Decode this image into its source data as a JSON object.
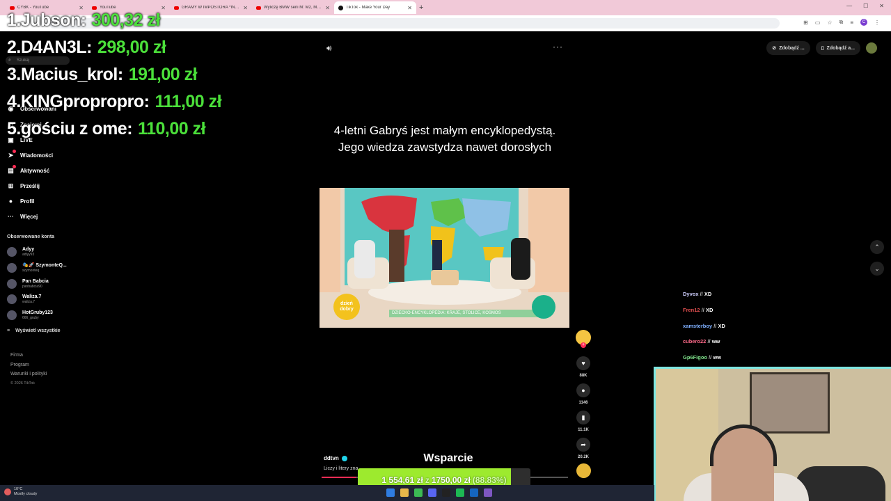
{
  "browser": {
    "tabs": [
      {
        "label": "CYBK - YouTube",
        "icon": "youtube-icon"
      },
      {
        "label": "YouTube",
        "icon": "youtube-icon"
      },
      {
        "label": "GRAMY W IMPOSTORA *INTEL",
        "icon": "youtube-icon"
      },
      {
        "label": "Wyliczę BMW serii M: M2, M3, M",
        "icon": "youtube-icon"
      },
      {
        "label": "TikTok - Make Your Day",
        "icon": "tiktok-icon",
        "active": true
      }
    ],
    "new_tab": "+"
  },
  "leaderboard": [
    {
      "rank_name": "1.Jubson:",
      "amount": "300,32 zł"
    },
    {
      "rank_name": "2.D4AN3L:",
      "amount": "298,00 zł"
    },
    {
      "rank_name": "3.Macius_krol:",
      "amount": "191,00 zł"
    },
    {
      "rank_name": "4.KINGpropropro:",
      "amount": "111,00 zł"
    },
    {
      "rank_name": "5.gościu z ome:",
      "amount": "110,00 zł"
    }
  ],
  "sidebar": {
    "search_placeholder": "Szukaj",
    "items": [
      {
        "label": "Obserwowani",
        "icon": "users-icon"
      },
      {
        "label": "Znajomi",
        "icon": "friends-icon"
      },
      {
        "label": "LIVE",
        "icon": "live-icon"
      },
      {
        "label": "Wiadomości",
        "icon": "messages-icon"
      },
      {
        "label": "Aktywność",
        "icon": "activity-icon"
      },
      {
        "label": "Prześlij",
        "icon": "upload-icon"
      },
      {
        "label": "Profil",
        "icon": "profile-icon"
      },
      {
        "label": "Więcej",
        "icon": "more-icon"
      }
    ],
    "following_title": "Obserwowane konta",
    "following": [
      {
        "name": "Adyy",
        "user": "adiyy93"
      },
      {
        "name": "🎭🚀 SzymonteQ...",
        "user": "szymonteq"
      },
      {
        "name": "Pan Babcia",
        "user": "panbabcia90"
      },
      {
        "name": "Waliza.7",
        "user": "waliza.7"
      },
      {
        "name": "HotGruby123",
        "user": "666_gruby"
      }
    ],
    "show_all": "Wyświetl wszystkie",
    "footer": [
      "Firma",
      "Program",
      "Warunki i polityki"
    ],
    "copyright": "© 2026 TikTok"
  },
  "top_right": {
    "btn1": "Zdobądź ...",
    "btn2": "Zdobądź a..."
  },
  "video": {
    "caption": "4-letni Gabryś jest małym encyklopedystą. Jego wiedza zawstydza nawet dorosłych",
    "clip_logo": "dzień dobry",
    "clip_ticker": "DZIECKO-ENCYKLOPEDIA: KRAJE, STOLICE, KOSMOS",
    "author": "ddtvn",
    "description": "Liczy i litery zna...",
    "progress": 0.14,
    "counts": {
      "likes": "88K",
      "comments": "1146",
      "saves": "11.1K",
      "shares": "20.2K"
    }
  },
  "chat": [
    {
      "user": "Dyvox",
      "color": "#cfcfff",
      "msg": "XD"
    },
    {
      "user": "Fren12",
      "color": "#e35050",
      "msg": "XD"
    },
    {
      "user": "xamsterboy",
      "color": "#7fb0ff",
      "msg": "XD"
    },
    {
      "user": "cubero22",
      "color": "#ff6a8a",
      "msg": "ww"
    },
    {
      "user": "Gp6Figoo",
      "color": "#7ee08a",
      "msg": "ww"
    }
  ],
  "goal": {
    "title": "Wsparcie",
    "current": "1 554,61 zł",
    "separator": "z",
    "target": "1750,00 zł",
    "percent": "(88.83%)",
    "fraction": 0.8883
  },
  "taskbar": {
    "temp": "10°C",
    "weather": "Mostly cloudy"
  }
}
